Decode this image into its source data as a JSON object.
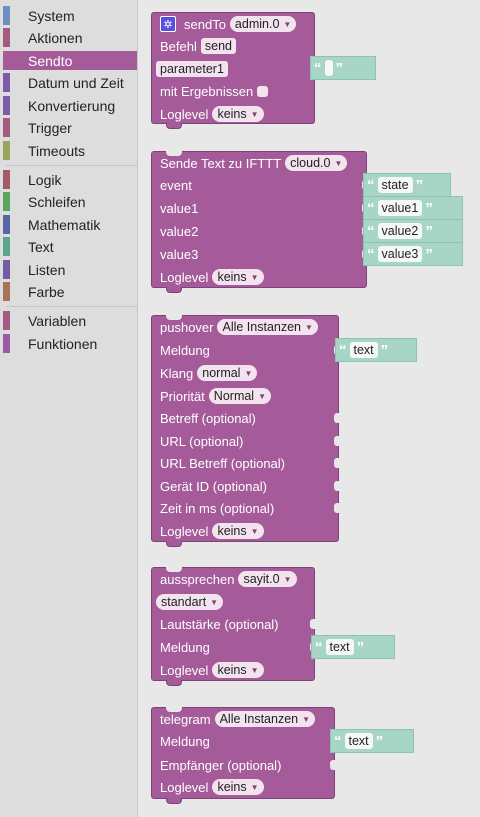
{
  "toolbox": {
    "categories": [
      {
        "label": "System",
        "color": "#6b8fc3"
      },
      {
        "label": "Aktionen",
        "color": "#a55b80"
      },
      {
        "label": "Sendto",
        "color": "#a55b99",
        "selected": true
      },
      {
        "label": "Datum und Zeit",
        "color": "#7d5bab"
      },
      {
        "label": "Konvertierung",
        "color": "#7d5bab"
      },
      {
        "label": "Trigger",
        "color": "#a55b80"
      },
      {
        "label": "Timeouts",
        "color": "#9aa55b"
      },
      {
        "label": "Logik",
        "color": "#a55b67"
      },
      {
        "label": "Schleifen",
        "color": "#5ba55b"
      },
      {
        "label": "Mathematik",
        "color": "#5b67a5"
      },
      {
        "label": "Text",
        "color": "#5ba58c"
      },
      {
        "label": "Listen",
        "color": "#745ba5"
      },
      {
        "label": "Farbe",
        "color": "#a5745b"
      },
      {
        "label": "Variablen",
        "color": "#a55b80"
      },
      {
        "label": "Funktionen",
        "color": "#995ba5"
      }
    ]
  },
  "blocks": {
    "sendto": {
      "title": "sendTo",
      "instance": "admin.0",
      "befehl_label": "Befehl",
      "befehl_value": "send",
      "param_label": "parameter1",
      "param_value": "",
      "results_label": "mit Ergebnissen",
      "loglevel_label": "Loglevel",
      "loglevel_value": "keins"
    },
    "ifttt": {
      "title": "Sende Text zu IFTTT",
      "instance": "cloud.0",
      "event_label": "event",
      "event_value": "state",
      "value1_label": "value1",
      "value1_value": "value1",
      "value2_label": "value2",
      "value2_value": "value2",
      "value3_label": "value3",
      "value3_value": "value3",
      "loglevel_label": "Loglevel",
      "loglevel_value": "keins"
    },
    "pushover": {
      "title": "pushover",
      "instance": "Alle Instanzen",
      "meldung_label": "Meldung",
      "meldung_value": "text",
      "klang_label": "Klang",
      "klang_value": "normal",
      "prio_label": "Priorität",
      "prio_value": "Normal",
      "betreff_label": "Betreff (optional)",
      "url_label": "URL (optional)",
      "urlbetreff_label": "URL Betreff (optional)",
      "geraet_label": "Gerät ID (optional)",
      "zeit_label": "Zeit in ms (optional)",
      "loglevel_label": "Loglevel",
      "loglevel_value": "keins"
    },
    "aussprechen": {
      "title": "aussprechen",
      "instance": "sayit.0",
      "mode_value": "standart",
      "laut_label": "Lautstärke (optional)",
      "meldung_label": "Meldung",
      "meldung_value": "text",
      "loglevel_label": "Loglevel",
      "loglevel_value": "keins"
    },
    "telegram": {
      "title": "telegram",
      "instance": "Alle Instanzen",
      "meldung_label": "Meldung",
      "meldung_value": "text",
      "empf_label": "Empfänger (optional)",
      "loglevel_label": "Loglevel",
      "loglevel_value": "keins"
    }
  },
  "quote_open": "“",
  "quote_close": "”",
  "dropdown_arrow": "▼"
}
